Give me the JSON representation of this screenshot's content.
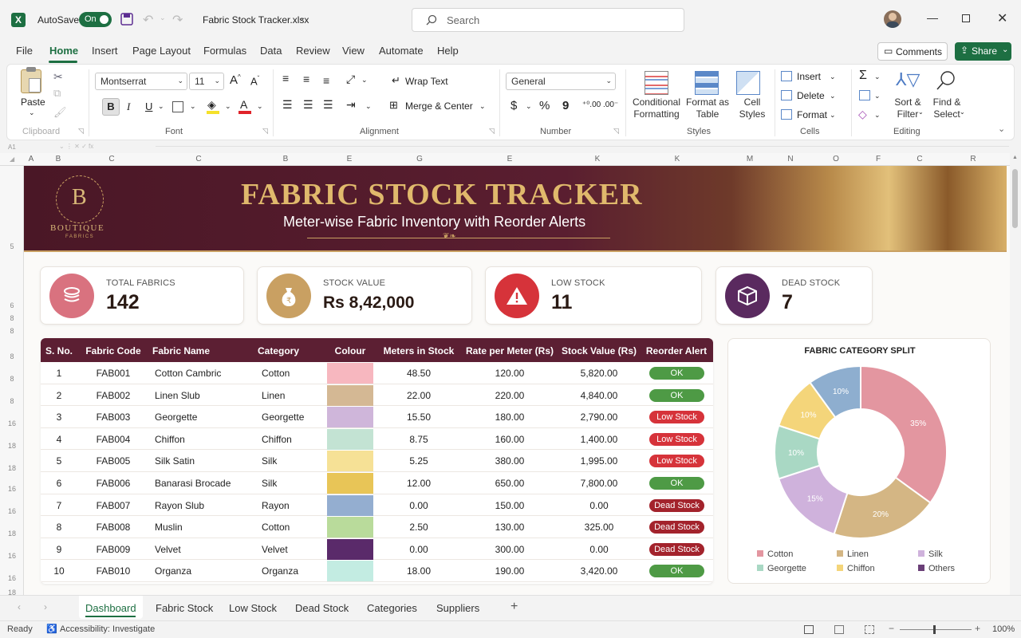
{
  "app": {
    "autosave_label": "AutoSave",
    "autosave_state": "On",
    "file_name": "Fabric Stock Tracker.xlsx",
    "search_placeholder": "Search"
  },
  "menu": {
    "items": [
      "File",
      "Home",
      "Insert",
      "Page Layout",
      "Formulas",
      "Data",
      "Review",
      "View",
      "Automate",
      "Help"
    ],
    "comments": "Comments",
    "share": "Share"
  },
  "ribbon": {
    "paste": "Paste",
    "clipboard": "Clipboard",
    "font_name": "Montserrat",
    "font_size": "11",
    "font_group": "Font",
    "bold": "B",
    "italic": "I",
    "underline": "U",
    "wrap_text": "Wrap Text",
    "merge_center": "Merge & Center",
    "alignment_group": "Alignment",
    "number_format": "General",
    "currency": "$",
    "percent": "%",
    "comma": "9",
    "number_group": "Number",
    "cond_fmt_1": "Conditional",
    "cond_fmt_2": "Formatting",
    "fmt_table_1": "Format as",
    "fmt_table_2": "Table",
    "cell_styles_1": "Cell",
    "cell_styles_2": "Styles",
    "styles_group": "Styles",
    "insert": "Insert",
    "delete": "Delete",
    "format": "Format",
    "cells_group": "Cells",
    "sort_1": "Sort &",
    "sort_2": "Filter",
    "find_1": "Find &",
    "find_2": "Select",
    "editing_group": "Editing"
  },
  "name_box": "A1",
  "columns": [
    "A",
    "B",
    "C",
    "C",
    "B",
    "E",
    "G",
    "E",
    "K",
    "K",
    "M",
    "N",
    "O",
    "F",
    "C",
    "R"
  ],
  "row_numbers": [
    "5",
    "6",
    "8",
    "8",
    "8",
    "8",
    "8",
    "16",
    "18",
    "18",
    "16",
    "16",
    "18",
    "16",
    "16",
    "18"
  ],
  "banner": {
    "logo_letter": "B",
    "logo_line1": "BOUTIQUE",
    "logo_line2": "FABRICS",
    "title": "FABRIC STOCK TRACKER",
    "subtitle": "Meter-wise Fabric Inventory with Reorder Alerts"
  },
  "kpis": [
    {
      "label": "TOTAL FABRICS",
      "value": "142",
      "color": "#d9727f",
      "icon": "stack-icon"
    },
    {
      "label": "STOCK VALUE",
      "value": "Rs 8,42,000",
      "color": "#c9a062",
      "icon": "money-bag-icon"
    },
    {
      "label": "LOW STOCK",
      "value": "11",
      "color": "#d6333a",
      "icon": "warning-icon"
    },
    {
      "label": "DEAD STOCK",
      "value": "7",
      "color": "#5a2a5f",
      "icon": "box-icon"
    }
  ],
  "table": {
    "headers": [
      "S. No.",
      "Fabric Code",
      "Fabric Name",
      "Category",
      "Colour",
      "Meters in Stock",
      "Rate per Meter (Rs)",
      "Stock Value (Rs)",
      "Reorder Alert"
    ],
    "rows": [
      {
        "sno": "1",
        "code": "FAB001",
        "name": "Cotton Cambric",
        "category": "Cotton",
        "colour": "#f7b7bf",
        "meters": "48.50",
        "rate": "120.00",
        "value": "5,820.00",
        "alert": "OK",
        "alert_color": "#4e9a45"
      },
      {
        "sno": "2",
        "code": "FAB002",
        "name": "Linen Slub",
        "category": "Linen",
        "colour": "#d4b894",
        "meters": "22.00",
        "rate": "220.00",
        "value": "4,840.00",
        "alert": "OK",
        "alert_color": "#4e9a45"
      },
      {
        "sno": "3",
        "code": "FAB003",
        "name": "Georgette",
        "category": "Georgette",
        "colour": "#cfb6da",
        "meters": "15.50",
        "rate": "180.00",
        "value": "2,790.00",
        "alert": "Low Stock",
        "alert_color": "#d6333a"
      },
      {
        "sno": "4",
        "code": "FAB004",
        "name": "Chiffon",
        "category": "Chiffon",
        "colour": "#c3e3d3",
        "meters": "8.75",
        "rate": "160.00",
        "value": "1,400.00",
        "alert": "Low Stock",
        "alert_color": "#d6333a"
      },
      {
        "sno": "5",
        "code": "FAB005",
        "name": "Silk Satin",
        "category": "Silk",
        "colour": "#f6e196",
        "meters": "5.25",
        "rate": "380.00",
        "value": "1,995.00",
        "alert": "Low Stock",
        "alert_color": "#d6333a"
      },
      {
        "sno": "6",
        "code": "FAB006",
        "name": "Banarasi Brocade",
        "category": "Silk",
        "colour": "#e8c557",
        "meters": "12.00",
        "rate": "650.00",
        "value": "7,800.00",
        "alert": "OK",
        "alert_color": "#4e9a45"
      },
      {
        "sno": "7",
        "code": "FAB007",
        "name": "Rayon Slub",
        "category": "Rayon",
        "colour": "#94aed0",
        "meters": "0.00",
        "rate": "150.00",
        "value": "0.00",
        "alert": "Dead Stock",
        "alert_color": "#a3232c"
      },
      {
        "sno": "8",
        "code": "FAB008",
        "name": "Muslin",
        "category": "Cotton",
        "colour": "#b9db9b",
        "meters": "2.50",
        "rate": "130.00",
        "value": "325.00",
        "alert": "Dead Stock",
        "alert_color": "#a3232c"
      },
      {
        "sno": "9",
        "code": "FAB009",
        "name": "Velvet",
        "category": "Velvet",
        "colour": "#5a2a6a",
        "meters": "0.00",
        "rate": "300.00",
        "value": "0.00",
        "alert": "Dead Stock",
        "alert_color": "#a3232c"
      },
      {
        "sno": "10",
        "code": "FAB010",
        "name": "Organza",
        "category": "Organza",
        "colour": "#c3ece2",
        "meters": "18.00",
        "rate": "190.00",
        "value": "3,420.00",
        "alert": "OK",
        "alert_color": "#4e9a45"
      }
    ]
  },
  "chart_data": {
    "type": "pie",
    "title": "FABRIC CATEGORY SPLIT",
    "categories": [
      "Cotton",
      "Linen",
      "Silk",
      "Georgette",
      "Chiffon",
      "Others"
    ],
    "slices": [
      {
        "label": "35%",
        "value": 35,
        "color": "#e396a0"
      },
      {
        "label": "20%",
        "value": 20,
        "color": "#d4b684"
      },
      {
        "label": "15%",
        "value": 15,
        "color": "#cfb2dc"
      },
      {
        "label": "10%",
        "value": 10,
        "color": "#a9d8c4"
      },
      {
        "label": "10%",
        "value": 10,
        "color": "#f4d57a"
      },
      {
        "label": "10%",
        "value": 10,
        "color": "#8eaecf"
      }
    ],
    "legend_colors": [
      "#e396a0",
      "#d4b684",
      "#cfb2dc",
      "#a9d8c4",
      "#f4d57a",
      "#6a3f78"
    ],
    "donut": true,
    "legend_position": "bottom"
  },
  "sheet_tabs": [
    "Dashboard",
    "Fabric Stock",
    "Low Stock",
    "Dead Stock",
    "Categories",
    "Suppliers"
  ],
  "status": {
    "ready": "Ready",
    "accessibility": "Accessibility: Investigate",
    "zoom": "100%"
  }
}
